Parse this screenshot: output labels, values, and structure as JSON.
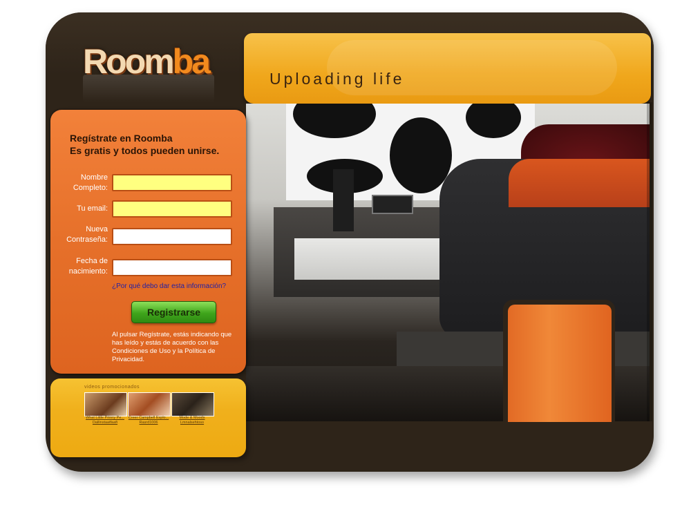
{
  "brand": {
    "logo_main": "Room",
    "logo_accent": "ba"
  },
  "banner": {
    "tagline": "Uploading life"
  },
  "registration": {
    "title_line1": "Regístrate en Roomba",
    "title_line2": "Es gratis y todos pueden unirse.",
    "fields": [
      {
        "label_line1": "Nombre",
        "label_line2": "Completo:",
        "value": "",
        "style": "yellow"
      },
      {
        "label_line1": "Tu email:",
        "label_line2": "",
        "value": "",
        "style": "yellow"
      },
      {
        "label_line1": "Nueva",
        "label_line2": "Contraseña:",
        "value": "",
        "style": "white"
      },
      {
        "label_line1": "Fecha de",
        "label_line2": "nacimiento:",
        "value": "",
        "style": "white"
      }
    ],
    "why_link": "¿Por qué debo dar esta información?",
    "submit_label": "Registrarse",
    "legal_text": "Al pulsar Regístrate, estás indicando que has leído y estás de acuerdo con las Condiciones de Uso y la Política de Privacidad."
  },
  "videos": {
    "heading": "videos promocionados",
    "items": [
      {
        "caption_line1": "What Little Prinny Pe...",
        "caption_line2": "Dallinstaatfaafi"
      },
      {
        "caption_line1": "Creer Campbell Explo...",
        "caption_line2": "Rasrd1006"
      },
      {
        "caption_line1": "Mode & Moods",
        "caption_line2": "Lmnalsehtoso"
      }
    ]
  },
  "colors": {
    "frame": "#2e2419",
    "accent_orange": "#e6702a",
    "banner_yellow": "#f0a71c",
    "button_green": "#3fa51c",
    "field_yellow": "#ffff80"
  }
}
